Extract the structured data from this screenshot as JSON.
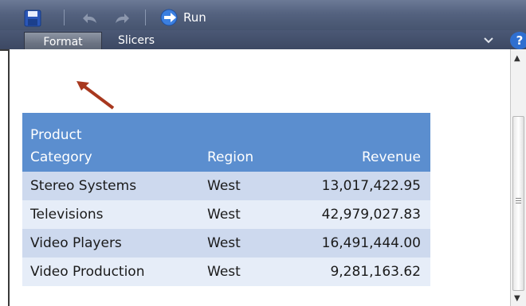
{
  "toolbar": {
    "run_label": "Run",
    "icons": [
      "save-icon",
      "undo-icon",
      "redo-icon",
      "run-icon"
    ]
  },
  "tabs": [
    {
      "label": "Format",
      "active": true
    },
    {
      "label": "Slicers",
      "active": false
    }
  ],
  "table": {
    "headers": {
      "category_line1": "Product",
      "category_line2": "Category",
      "region": "Region",
      "revenue": "Revenue"
    },
    "rows": [
      {
        "category": "Stereo Systems",
        "region": "West",
        "revenue": "13,017,422.95"
      },
      {
        "category": "Televisions",
        "region": "West",
        "revenue": "42,979,027.83"
      },
      {
        "category": "Video Players",
        "region": "West",
        "revenue": "16,491,444.00"
      },
      {
        "category": "Video Production",
        "region": "West",
        "revenue": "9,281,163.62"
      }
    ]
  },
  "colors": {
    "header_bg": "#5b8ecf",
    "row_odd": "#cdd9ee",
    "row_even": "#e6edf8",
    "arrow": "#a8381e",
    "toolbar_bg": "#4a5875"
  }
}
